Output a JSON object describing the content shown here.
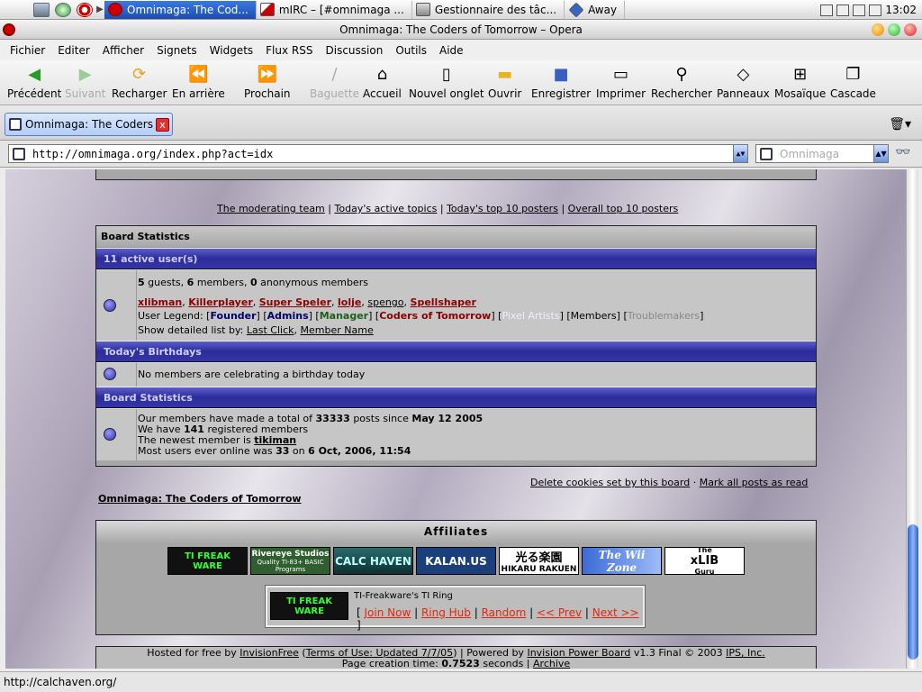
{
  "menubar": {
    "tasks": [
      {
        "label": "Omnimaga: The Cod...",
        "active": true
      },
      {
        "label": "mIRC – [#omnimaga ...",
        "active": false
      },
      {
        "label": "Gestionnaire des tâc...",
        "active": false
      },
      {
        "label": "Away",
        "active": false
      }
    ],
    "clock": "13:02"
  },
  "window": {
    "title": "Omnimaga: The Coders of Tomorrow – Opera"
  },
  "appmenu": [
    "Fichier",
    "Editer",
    "Afficher",
    "Signets",
    "Widgets",
    "Flux RSS",
    "Discussion",
    "Outils",
    "Aide"
  ],
  "toolbar": {
    "precedent": "Précédent",
    "suivant": "Suivant",
    "recharger": "Recharger",
    "arriere": "En arrière",
    "prochain": "Prochain",
    "baguette": "Baguette",
    "accueil": "Accueil",
    "nouvel_onglet": "Nouvel onglet",
    "ouvrir": "Ouvrir",
    "enregistrer": "Enregistrer",
    "imprimer": "Imprimer",
    "rechercher": "Rechercher",
    "panneaux": "Panneaux",
    "mosaique": "Mosaïque",
    "cascade": "Cascade"
  },
  "tab": {
    "label": "Omnimaga: The Coders ...",
    "close": "x"
  },
  "address": {
    "url": "http://omnimaga.org/index.php?act=idx",
    "search_placeholder": "Omnimaga"
  },
  "page": {
    "top_links": {
      "mod": "The moderating team",
      "active": "Today's active topics",
      "top10": "Today's top 10 posters",
      "overall": "Overall top 10 posters",
      "sep": "|"
    },
    "board_stats_title": "Board Statistics",
    "active_users": {
      "header": "11 active user(s)",
      "guests": "5",
      "guests_label": "guests,",
      "members": "6",
      "members_label": "members,",
      "anon": "0",
      "anon_label": "anonymous members",
      "users": [
        "xlibman",
        "Killerplayer",
        "Super Speler",
        "lolje",
        "spengo",
        "Spellshaper"
      ],
      "legend_label": "User Legend:",
      "legend": {
        "founder": "Founder",
        "admins": "Admins",
        "manager": "Manager",
        "cot": "Coders of Tomorrow",
        "pixel": "Pixel Artists",
        "members": "Members",
        "trouble": "Troublemakers"
      },
      "detail_label": "Show detailed list by:",
      "last_click": "Last Click",
      "member_name": "Member Name"
    },
    "birthdays": {
      "header": "Today's Birthdays",
      "text": "No members are celebrating a birthday today"
    },
    "stats": {
      "header": "Board Statistics",
      "line1_pre": "Our members have made a total of",
      "posts": "33333",
      "line1_mid": "posts since",
      "since": "May 12 2005",
      "line2_pre": "We have",
      "registered": "141",
      "line2_post": "registered members",
      "line3_pre": "The newest member is",
      "newest": "tikiman",
      "line4_pre": "Most users ever online was",
      "max": "33",
      "line4_mid": "on",
      "max_date": "6 Oct, 2006, 11:54"
    },
    "cookie_links": {
      "delete": "Delete cookies set by this board",
      "dot": "·",
      "mark": "Mark all posts as read"
    },
    "site_name": "Omnimaga: The Coders of Tomorrow",
    "affiliates": {
      "header": "Affiliates",
      "banners": [
        "TI FREAK WARE",
        "Rivereye Studios",
        "Quality TI-83+ BASIC Programs",
        "CALC HAVEN",
        "KALAN.US",
        "光る楽園",
        "HIKARU RAKUEN",
        "The Wii Zone",
        "The",
        "xLIB",
        "Guru"
      ],
      "ring_title": "TI-Freakware's TI Ring",
      "ring_links": [
        "Join Now",
        "Ring Hub",
        "Random",
        "<< Prev",
        "Next >>"
      ]
    },
    "footer": {
      "hosted": "Hosted for free by",
      "invisionfree": "InvisionFree",
      "terms": "Terms of Use: Updated 7/7/05",
      "powered": "Powered by",
      "ipb": "Invision Power Board",
      "version": "v1.3 Final © 2003",
      "ips": "IPS, Inc.",
      "creation": "Page creation time:",
      "time": "0.7523",
      "seconds": "seconds",
      "archive": "Archive"
    }
  },
  "status": {
    "text": "http://calchaven.org/"
  },
  "colors": {
    "accent": "#2c2c99",
    "ring_link": "#e0280f",
    "user": "#8b0000"
  }
}
